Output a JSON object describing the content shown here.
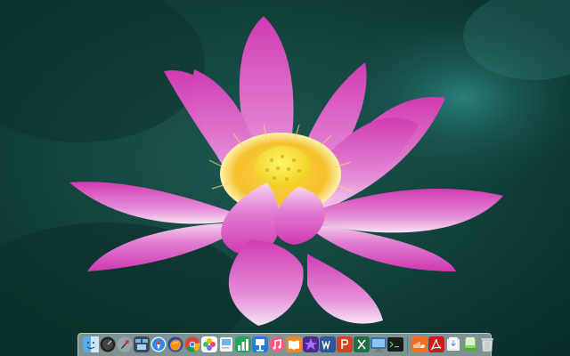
{
  "desktop": {
    "wallpaper": "pink-lotus-flower",
    "colors": {
      "background": "#0f3b35",
      "petal": "#d33bb5",
      "petal_light": "#f3c8ec",
      "seedpod": "#ffe84a"
    }
  },
  "dock": {
    "items": [
      {
        "name": "finder-icon"
      },
      {
        "name": "dashboard-icon"
      },
      {
        "name": "launchpad-icon"
      },
      {
        "name": "mission-control-icon"
      },
      {
        "name": "safari-icon"
      },
      {
        "name": "firefox-icon"
      },
      {
        "name": "chrome-icon"
      },
      {
        "name": "photos-icon"
      },
      {
        "name": "preview-icon"
      },
      {
        "name": "numbers-icon"
      },
      {
        "name": "keynote-icon"
      },
      {
        "name": "itunes-icon"
      },
      {
        "name": "books-icon"
      },
      {
        "name": "imovie-icon"
      },
      {
        "name": "word-icon"
      },
      {
        "name": "powerpoint-icon"
      },
      {
        "name": "excel-icon"
      },
      {
        "name": "system-info-icon"
      },
      {
        "name": "terminal-icon"
      },
      {
        "name": "soundcloud-icon"
      },
      {
        "name": "acrobat-icon"
      },
      {
        "name": "downloads-stack-icon"
      },
      {
        "name": "documents-stack-icon"
      },
      {
        "name": "trash-icon"
      }
    ]
  }
}
